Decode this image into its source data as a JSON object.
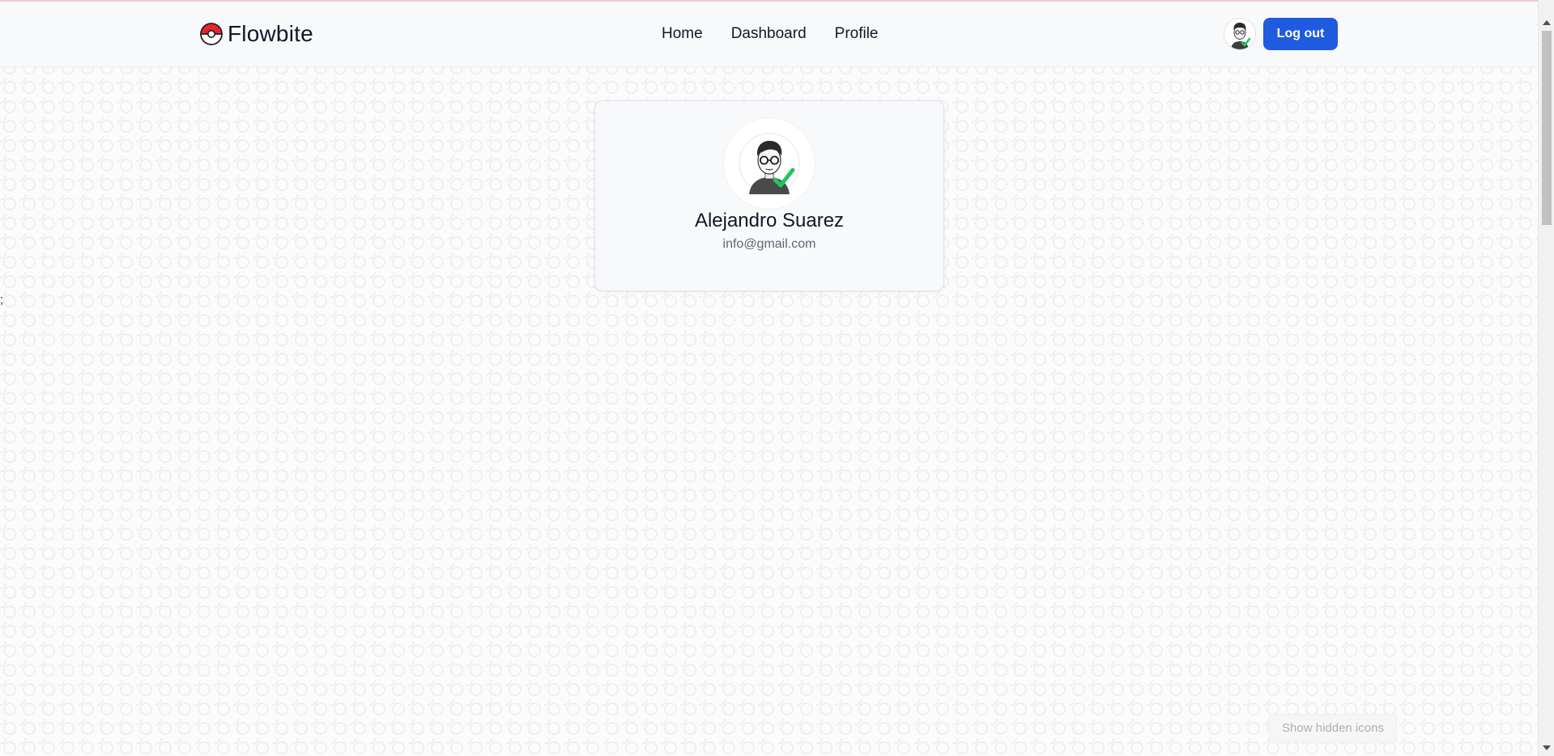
{
  "brand": {
    "name": "Flowbite",
    "logo_icon": "pokeball-icon"
  },
  "nav": {
    "items": [
      {
        "label": "Home"
      },
      {
        "label": "Dashboard"
      },
      {
        "label": "Profile"
      }
    ]
  },
  "header": {
    "logout_label": "Log out",
    "avatar_icon": "user-avatar-icon"
  },
  "profile": {
    "name": "Alejandro Suarez",
    "email": "info@gmail.com",
    "avatar_icon": "user-avatar-verified-icon"
  },
  "stray_text": ";",
  "tooltip": {
    "text": "Show hidden icons"
  },
  "colors": {
    "primary": "#1f5be0",
    "badge": "#22c55e",
    "logo_red": "#e3262b"
  }
}
